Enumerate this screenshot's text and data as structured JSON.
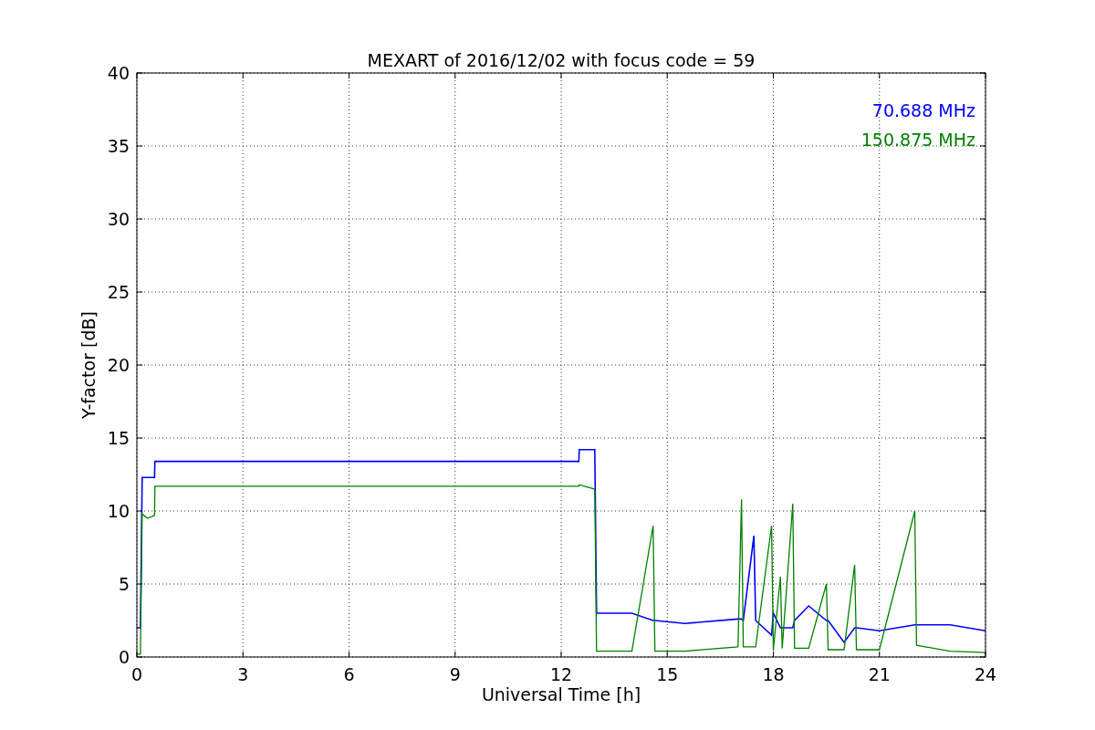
{
  "chart": {
    "chart_data": {
      "type": "line",
      "title": "MEXART of 2016/12/02 with focus code = 59",
      "xlabel": "Universal Time [h]",
      "ylabel": "Y-factor [dB]",
      "x": [
        0,
        0.1,
        0.15,
        0.3,
        0.5,
        0.51,
        12.5,
        12.51,
        12.95,
        13.0,
        14.0,
        14.6,
        14.65,
        15.5,
        17.0,
        17.1,
        17.15,
        17.45,
        17.5,
        17.95,
        18.0,
        18.2,
        18.25,
        18.55,
        18.6,
        19.0,
        19.5,
        19.55,
        20.0,
        20.3,
        20.35,
        21.0,
        22.0,
        22.05,
        23.0,
        24
      ],
      "series": [
        {
          "name": "70.688 MHz",
          "color": "#0000ff",
          "values": [
            2,
            2,
            12.3,
            12.3,
            12.3,
            13.4,
            13.4,
            14.2,
            14.2,
            3,
            3,
            2.5,
            2.5,
            2.3,
            2.6,
            2.6,
            2.5,
            8.3,
            2.5,
            1.5,
            3,
            2,
            2,
            2,
            2.5,
            3.5,
            2.5,
            2.5,
            1,
            2,
            2,
            1.8,
            2.2,
            2.2,
            2.2,
            1.8
          ]
        },
        {
          "name": "150.875 MHz",
          "color": "#008000",
          "values": [
            0.2,
            0.2,
            9.8,
            9.5,
            9.7,
            11.7,
            11.7,
            11.8,
            11.5,
            0.4,
            0.4,
            9,
            0.4,
            0.4,
            0.7,
            10.8,
            0.7,
            0.7,
            0.7,
            9,
            0.5,
            5.5,
            0.6,
            10.5,
            0.6,
            0.6,
            5,
            0.5,
            0.5,
            6.3,
            0.5,
            0.5,
            10,
            0.8,
            0.4,
            0.3
          ]
        }
      ],
      "xlim": [
        0,
        24
      ],
      "ylim": [
        0,
        40
      ],
      "xticks": [
        0,
        3,
        6,
        9,
        12,
        15,
        18,
        21,
        24
      ],
      "yticks": [
        0,
        5,
        10,
        15,
        20,
        25,
        30,
        35,
        40
      ],
      "grid": true
    }
  }
}
